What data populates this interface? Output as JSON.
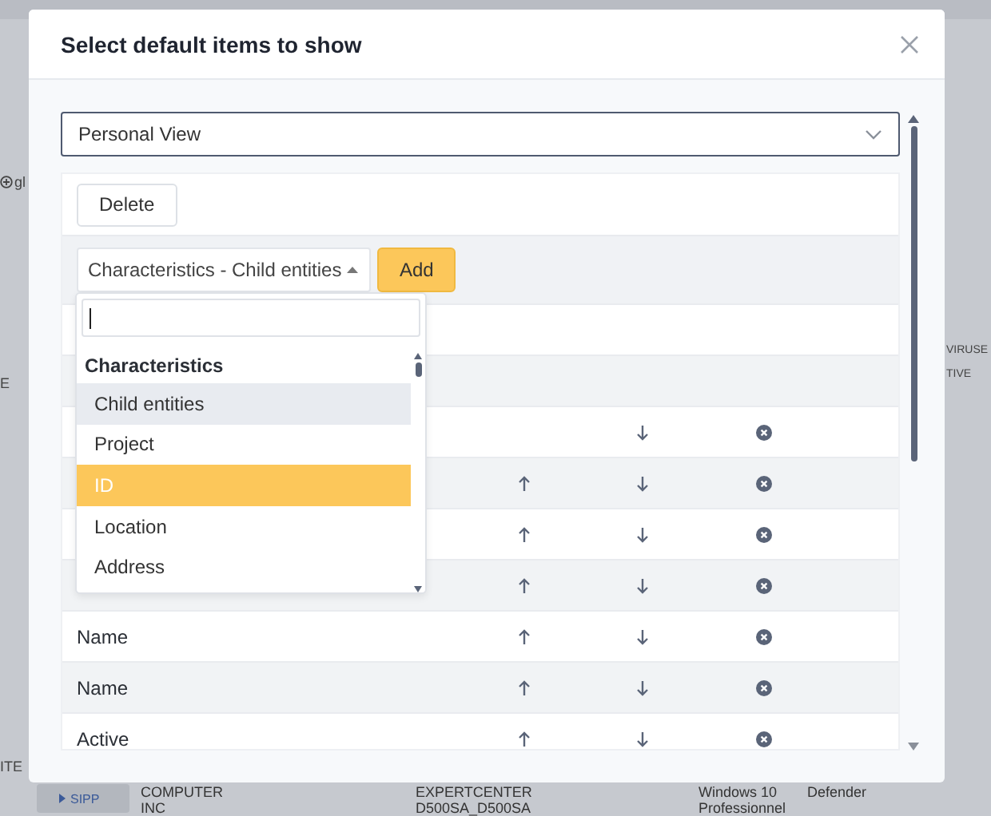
{
  "background": {
    "left_labels": [
      {
        "text": "gl",
        "icon": true
      },
      {
        "text": "E",
        "icon": false
      },
      {
        "text": "ITE",
        "icon": false
      }
    ],
    "right_labels": [
      "VIRUSE",
      "TIVE"
    ],
    "bottom_row": {
      "tag": "SIPP",
      "cells": [
        [
          "COMPUTER",
          "INC"
        ],
        [
          "EXPERTCENTER",
          "D500SA_D500SA"
        ],
        [
          "Windows 10",
          "Professionnel"
        ],
        [
          "Defender"
        ]
      ]
    }
  },
  "dialog": {
    "title": "Select default items to show",
    "view_select": {
      "value": "Personal View"
    },
    "delete_button": "Delete",
    "add_select": {
      "value": "Characteristics - Child entities",
      "open": true
    },
    "add_button": "Add",
    "rows": [
      {
        "kind": "blank"
      },
      {
        "kind": "blank"
      },
      {
        "kind": "item",
        "can_up": false,
        "can_down": true
      },
      {
        "kind": "item",
        "can_up": true,
        "can_down": true
      },
      {
        "kind": "item",
        "can_up": true,
        "can_down": true
      },
      {
        "kind": "item",
        "can_up": true,
        "can_down": true
      },
      {
        "kind": "item",
        "label": "Name",
        "can_up": true,
        "can_down": true
      },
      {
        "kind": "item",
        "label": "Name",
        "can_up": true,
        "can_down": true
      },
      {
        "kind": "item",
        "label": "Active",
        "can_up": true,
        "can_down": true
      }
    ],
    "dropdown": {
      "group": "Characteristics",
      "options": [
        {
          "label": "Child entities",
          "selected": false,
          "hovered": true
        },
        {
          "label": "Project",
          "selected": false,
          "hovered": false
        },
        {
          "label": "ID",
          "selected": true,
          "hovered": false
        },
        {
          "label": "Location",
          "selected": false,
          "hovered": false
        },
        {
          "label": "Address",
          "selected": false,
          "hovered": false
        }
      ]
    }
  }
}
